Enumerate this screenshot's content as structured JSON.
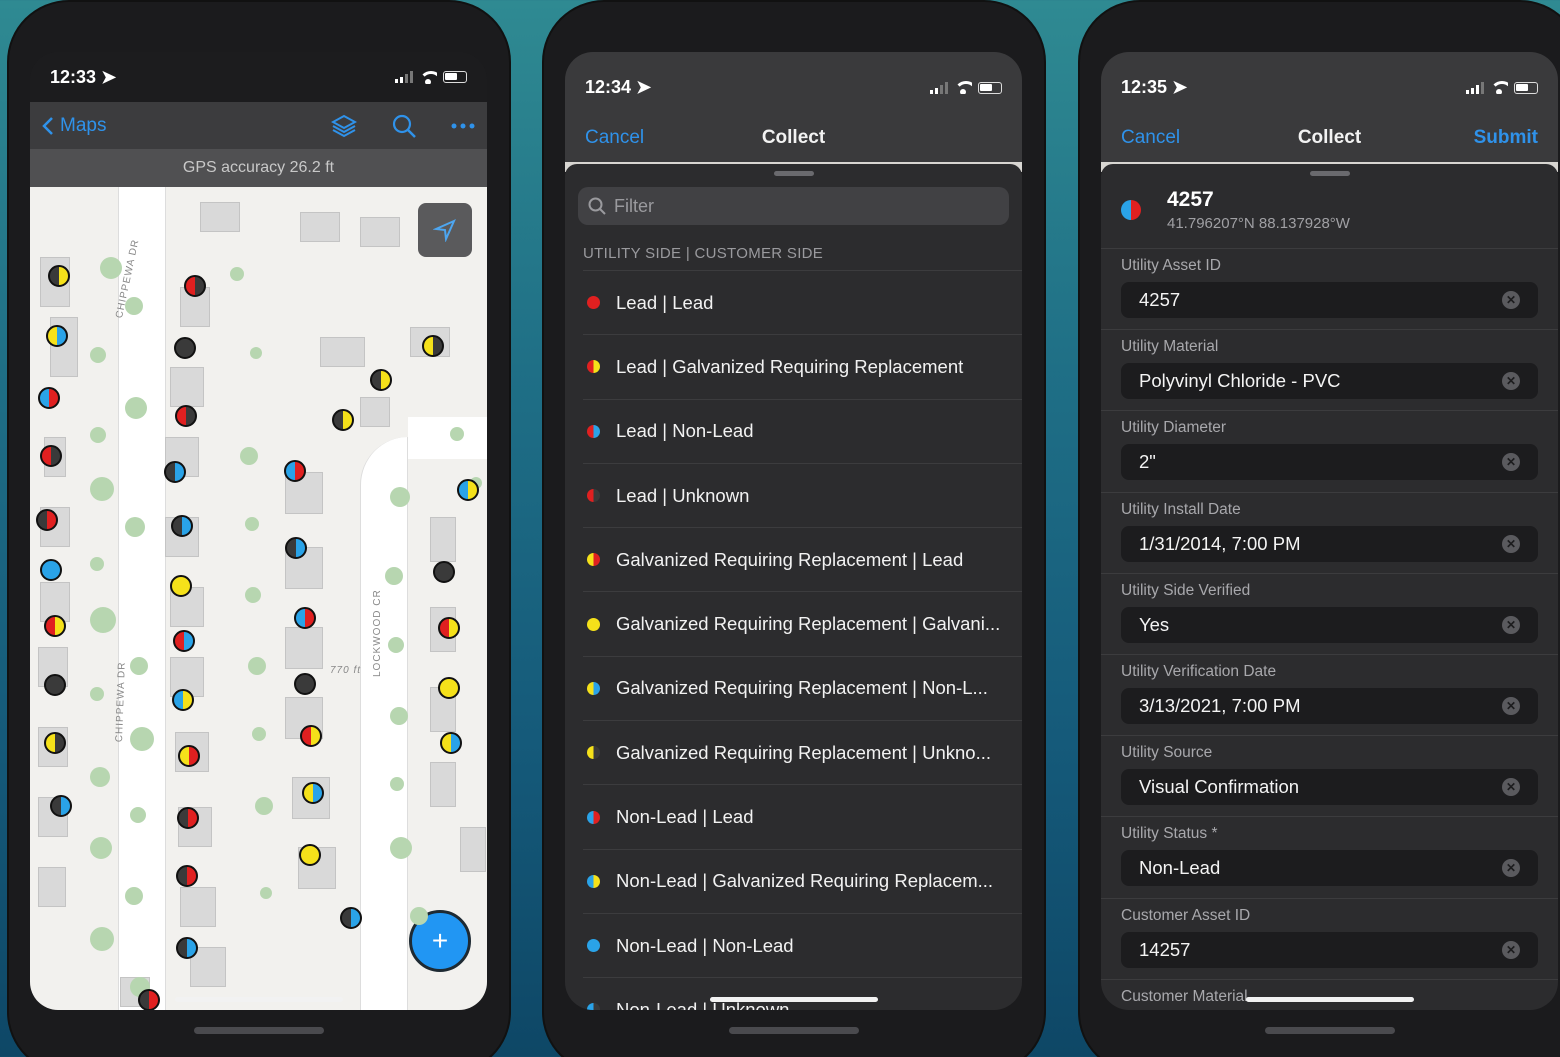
{
  "phone1": {
    "time": "12:33",
    "nav_back": "Maps",
    "gps": "GPS accuracy 26.2 ft",
    "street_1": "CHIPPEWA DR",
    "street_2": "CHIPPEWA DR",
    "street_3": "LOCKWOOD CR",
    "scale_label": "770 ft",
    "icons": [
      "layers-icon",
      "search-icon",
      "more-icon",
      "location-arrow-icon",
      "add-icon"
    ]
  },
  "phone2": {
    "time": "12:34",
    "cancel": "Cancel",
    "title": "Collect",
    "filter_placeholder": "Filter",
    "section_header": "UTILITY SIDE | CUSTOMER SIDE",
    "options": [
      {
        "label": "Lead | Lead",
        "colors": [
          "#e02020",
          "#e02020"
        ]
      },
      {
        "label": "Lead | Galvanized Requiring Replacement",
        "colors": [
          "#e02020",
          "#f5e11a"
        ]
      },
      {
        "label": "Lead | Non-Lead",
        "colors": [
          "#e02020",
          "#2aa3e8"
        ]
      },
      {
        "label": "Lead | Unknown",
        "colors": [
          "#e02020",
          "#3a3a3a"
        ]
      },
      {
        "label": "Galvanized Requiring Replacement | Lead",
        "colors": [
          "#f5e11a",
          "#e02020"
        ]
      },
      {
        "label": "Galvanized Requiring Replacement | Galvani...",
        "colors": [
          "#f5e11a",
          "#f5e11a"
        ]
      },
      {
        "label": "Galvanized Requiring Replacement | Non-L...",
        "colors": [
          "#f5e11a",
          "#2aa3e8"
        ]
      },
      {
        "label": "Galvanized Requiring Replacement | Unkno...",
        "colors": [
          "#f5e11a",
          "#3a3a3a"
        ]
      },
      {
        "label": "Non-Lead | Lead",
        "colors": [
          "#2aa3e8",
          "#e02020"
        ]
      },
      {
        "label": "Non-Lead | Galvanized Requiring Replacem...",
        "colors": [
          "#2aa3e8",
          "#f5e11a"
        ]
      },
      {
        "label": "Non-Lead | Non-Lead",
        "colors": [
          "#2aa3e8",
          "#2aa3e8"
        ]
      },
      {
        "label": "Non-Lead | Unknown",
        "colors": [
          "#2aa3e8",
          "#3a3a3a"
        ]
      }
    ]
  },
  "phone3": {
    "time": "12:35",
    "cancel": "Cancel",
    "title": "Collect",
    "submit": "Submit",
    "record_title": "4257",
    "record_coords": "41.796207°N  88.137928°W",
    "fields": [
      {
        "label": "Utility Asset ID",
        "value": "4257"
      },
      {
        "label": "Utility Material",
        "value": "Polyvinyl Chloride - PVC"
      },
      {
        "label": "Utility Diameter",
        "value": "2\""
      },
      {
        "label": "Utility Install Date",
        "value": "1/31/2014, 7:00 PM"
      },
      {
        "label": "Utility Side Verified",
        "value": "Yes"
      },
      {
        "label": "Utility Verification Date",
        "value": "3/13/2021, 7:00 PM"
      },
      {
        "label": "Utility Source",
        "value": "Visual Confirmation"
      },
      {
        "label": "Utility Status *",
        "value": "Non-Lead"
      },
      {
        "label": "Customer Asset ID",
        "value": "14257"
      },
      {
        "label": "Customer Material",
        "value": ""
      }
    ]
  },
  "colors": {
    "accent": "#2f92ea",
    "lead": "#e02020",
    "galvanized": "#f5e11a",
    "non_lead": "#2aa3e8",
    "unknown": "#3a3a3a"
  }
}
